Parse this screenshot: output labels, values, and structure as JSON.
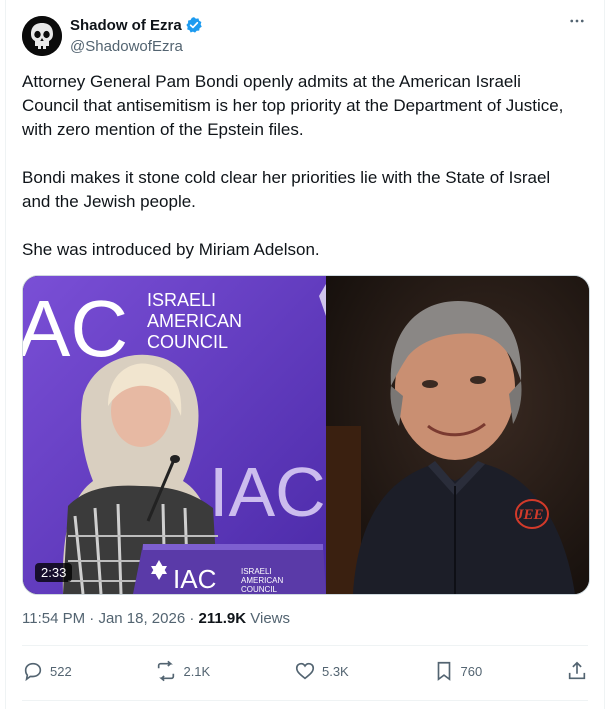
{
  "author": {
    "name": "Shadow of Ezra",
    "handle": "@ShadowofEzra",
    "verified": true,
    "verified_color": "#1d9bf0"
  },
  "tweet": {
    "paragraphs": [
      "Attorney General Pam Bondi openly admits at the American Israeli Council that antisemitism is her top priority at the Department of Justice, with zero mention of the Epstein files.",
      "Bondi makes it stone cold clear her priorities lie with the State of Israel and the Jewish people.",
      "She was introduced by Miriam Adelson."
    ]
  },
  "media": {
    "duration": "2:33",
    "left_panel_text": {
      "logo_big": "AC",
      "line1": "ISRAELI",
      "line2": "AMERICAN",
      "line3": "COUNCIL",
      "podium_logo": "IAC",
      "podium_line1": "ISRAELI",
      "podium_line2": "AMERICAN",
      "podium_line3": "COUNCIL",
      "backdrop_big": "IAC"
    },
    "right_panel_text": {
      "monogram": "JEE"
    }
  },
  "meta": {
    "time": "11:54 PM",
    "sep": "·",
    "date": "Jan 18, 2026",
    "views_count": "211.9K",
    "views_label": "Views"
  },
  "actions": {
    "replies": "522",
    "reposts": "2.1K",
    "likes": "5.3K",
    "bookmarks": "760"
  },
  "colors": {
    "text_primary": "#0f1419",
    "text_secondary": "#536471",
    "stage_purple": "#6b3fc3"
  }
}
